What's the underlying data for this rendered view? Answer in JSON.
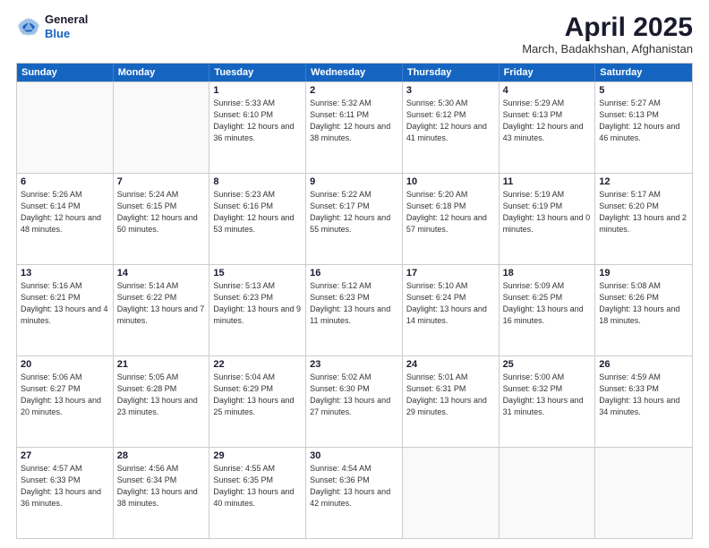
{
  "header": {
    "logo": {
      "line1": "General",
      "line2": "Blue"
    },
    "title": "April 2025",
    "subtitle": "March, Badakhshan, Afghanistan"
  },
  "weekdays": [
    "Sunday",
    "Monday",
    "Tuesday",
    "Wednesday",
    "Thursday",
    "Friday",
    "Saturday"
  ],
  "weeks": [
    [
      {
        "day": "",
        "empty": true
      },
      {
        "day": "",
        "empty": true
      },
      {
        "day": "1",
        "sunrise": "Sunrise: 5:33 AM",
        "sunset": "Sunset: 6:10 PM",
        "daylight": "Daylight: 12 hours and 36 minutes."
      },
      {
        "day": "2",
        "sunrise": "Sunrise: 5:32 AM",
        "sunset": "Sunset: 6:11 PM",
        "daylight": "Daylight: 12 hours and 38 minutes."
      },
      {
        "day": "3",
        "sunrise": "Sunrise: 5:30 AM",
        "sunset": "Sunset: 6:12 PM",
        "daylight": "Daylight: 12 hours and 41 minutes."
      },
      {
        "day": "4",
        "sunrise": "Sunrise: 5:29 AM",
        "sunset": "Sunset: 6:13 PM",
        "daylight": "Daylight: 12 hours and 43 minutes."
      },
      {
        "day": "5",
        "sunrise": "Sunrise: 5:27 AM",
        "sunset": "Sunset: 6:13 PM",
        "daylight": "Daylight: 12 hours and 46 minutes."
      }
    ],
    [
      {
        "day": "6",
        "sunrise": "Sunrise: 5:26 AM",
        "sunset": "Sunset: 6:14 PM",
        "daylight": "Daylight: 12 hours and 48 minutes."
      },
      {
        "day": "7",
        "sunrise": "Sunrise: 5:24 AM",
        "sunset": "Sunset: 6:15 PM",
        "daylight": "Daylight: 12 hours and 50 minutes."
      },
      {
        "day": "8",
        "sunrise": "Sunrise: 5:23 AM",
        "sunset": "Sunset: 6:16 PM",
        "daylight": "Daylight: 12 hours and 53 minutes."
      },
      {
        "day": "9",
        "sunrise": "Sunrise: 5:22 AM",
        "sunset": "Sunset: 6:17 PM",
        "daylight": "Daylight: 12 hours and 55 minutes."
      },
      {
        "day": "10",
        "sunrise": "Sunrise: 5:20 AM",
        "sunset": "Sunset: 6:18 PM",
        "daylight": "Daylight: 12 hours and 57 minutes."
      },
      {
        "day": "11",
        "sunrise": "Sunrise: 5:19 AM",
        "sunset": "Sunset: 6:19 PM",
        "daylight": "Daylight: 13 hours and 0 minutes."
      },
      {
        "day": "12",
        "sunrise": "Sunrise: 5:17 AM",
        "sunset": "Sunset: 6:20 PM",
        "daylight": "Daylight: 13 hours and 2 minutes."
      }
    ],
    [
      {
        "day": "13",
        "sunrise": "Sunrise: 5:16 AM",
        "sunset": "Sunset: 6:21 PM",
        "daylight": "Daylight: 13 hours and 4 minutes."
      },
      {
        "day": "14",
        "sunrise": "Sunrise: 5:14 AM",
        "sunset": "Sunset: 6:22 PM",
        "daylight": "Daylight: 13 hours and 7 minutes."
      },
      {
        "day": "15",
        "sunrise": "Sunrise: 5:13 AM",
        "sunset": "Sunset: 6:23 PM",
        "daylight": "Daylight: 13 hours and 9 minutes."
      },
      {
        "day": "16",
        "sunrise": "Sunrise: 5:12 AM",
        "sunset": "Sunset: 6:23 PM",
        "daylight": "Daylight: 13 hours and 11 minutes."
      },
      {
        "day": "17",
        "sunrise": "Sunrise: 5:10 AM",
        "sunset": "Sunset: 6:24 PM",
        "daylight": "Daylight: 13 hours and 14 minutes."
      },
      {
        "day": "18",
        "sunrise": "Sunrise: 5:09 AM",
        "sunset": "Sunset: 6:25 PM",
        "daylight": "Daylight: 13 hours and 16 minutes."
      },
      {
        "day": "19",
        "sunrise": "Sunrise: 5:08 AM",
        "sunset": "Sunset: 6:26 PM",
        "daylight": "Daylight: 13 hours and 18 minutes."
      }
    ],
    [
      {
        "day": "20",
        "sunrise": "Sunrise: 5:06 AM",
        "sunset": "Sunset: 6:27 PM",
        "daylight": "Daylight: 13 hours and 20 minutes."
      },
      {
        "day": "21",
        "sunrise": "Sunrise: 5:05 AM",
        "sunset": "Sunset: 6:28 PM",
        "daylight": "Daylight: 13 hours and 23 minutes."
      },
      {
        "day": "22",
        "sunrise": "Sunrise: 5:04 AM",
        "sunset": "Sunset: 6:29 PM",
        "daylight": "Daylight: 13 hours and 25 minutes."
      },
      {
        "day": "23",
        "sunrise": "Sunrise: 5:02 AM",
        "sunset": "Sunset: 6:30 PM",
        "daylight": "Daylight: 13 hours and 27 minutes."
      },
      {
        "day": "24",
        "sunrise": "Sunrise: 5:01 AM",
        "sunset": "Sunset: 6:31 PM",
        "daylight": "Daylight: 13 hours and 29 minutes."
      },
      {
        "day": "25",
        "sunrise": "Sunrise: 5:00 AM",
        "sunset": "Sunset: 6:32 PM",
        "daylight": "Daylight: 13 hours and 31 minutes."
      },
      {
        "day": "26",
        "sunrise": "Sunrise: 4:59 AM",
        "sunset": "Sunset: 6:33 PM",
        "daylight": "Daylight: 13 hours and 34 minutes."
      }
    ],
    [
      {
        "day": "27",
        "sunrise": "Sunrise: 4:57 AM",
        "sunset": "Sunset: 6:33 PM",
        "daylight": "Daylight: 13 hours and 36 minutes."
      },
      {
        "day": "28",
        "sunrise": "Sunrise: 4:56 AM",
        "sunset": "Sunset: 6:34 PM",
        "daylight": "Daylight: 13 hours and 38 minutes."
      },
      {
        "day": "29",
        "sunrise": "Sunrise: 4:55 AM",
        "sunset": "Sunset: 6:35 PM",
        "daylight": "Daylight: 13 hours and 40 minutes."
      },
      {
        "day": "30",
        "sunrise": "Sunrise: 4:54 AM",
        "sunset": "Sunset: 6:36 PM",
        "daylight": "Daylight: 13 hours and 42 minutes."
      },
      {
        "day": "",
        "empty": true
      },
      {
        "day": "",
        "empty": true
      },
      {
        "day": "",
        "empty": true
      }
    ]
  ]
}
